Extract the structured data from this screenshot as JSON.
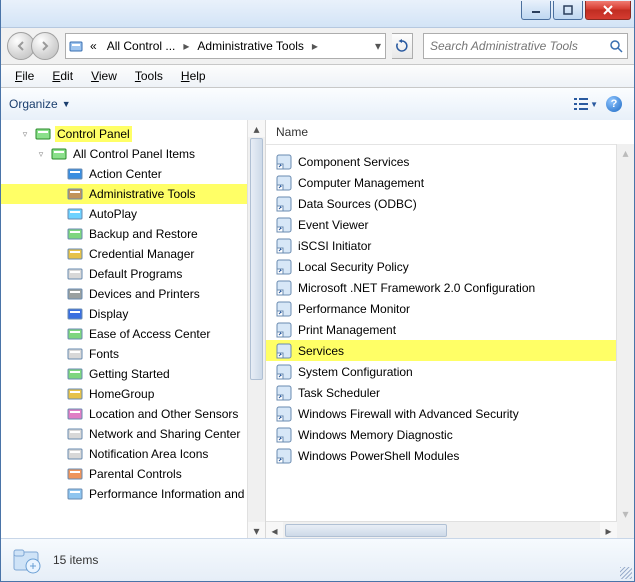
{
  "breadcrumbs": {
    "root_glyph": "«",
    "item1": "All Control ...",
    "item2": "Administrative Tools"
  },
  "search": {
    "placeholder": "Search Administrative Tools"
  },
  "menu": {
    "file": "File",
    "edit": "Edit",
    "view": "View",
    "tools": "Tools",
    "help": "Help"
  },
  "toolbar": {
    "organize": "Organize"
  },
  "columns": {
    "name": "Name"
  },
  "tree": {
    "root": "Control Panel",
    "all": "All Control Panel Items",
    "items": [
      "Action Center",
      "Administrative Tools",
      "AutoPlay",
      "Backup and Restore",
      "Credential Manager",
      "Default Programs",
      "Devices and Printers",
      "Display",
      "Ease of Access Center",
      "Fonts",
      "Getting Started",
      "HomeGroup",
      "Location and Other Sensors",
      "Network and Sharing Center",
      "Notification Area Icons",
      "Parental Controls",
      "Performance Information and T"
    ]
  },
  "list": {
    "items": [
      "Component Services",
      "Computer Management",
      "Data Sources (ODBC)",
      "Event Viewer",
      "iSCSI Initiator",
      "Local Security Policy",
      "Microsoft .NET Framework 2.0 Configuration",
      "Performance Monitor",
      "Print Management",
      "Services",
      "System Configuration",
      "Task Scheduler",
      "Windows Firewall with Advanced Security",
      "Windows Memory Diagnostic",
      "Windows PowerShell Modules"
    ],
    "highlight_index": 9
  },
  "status": {
    "count": "15 items"
  }
}
